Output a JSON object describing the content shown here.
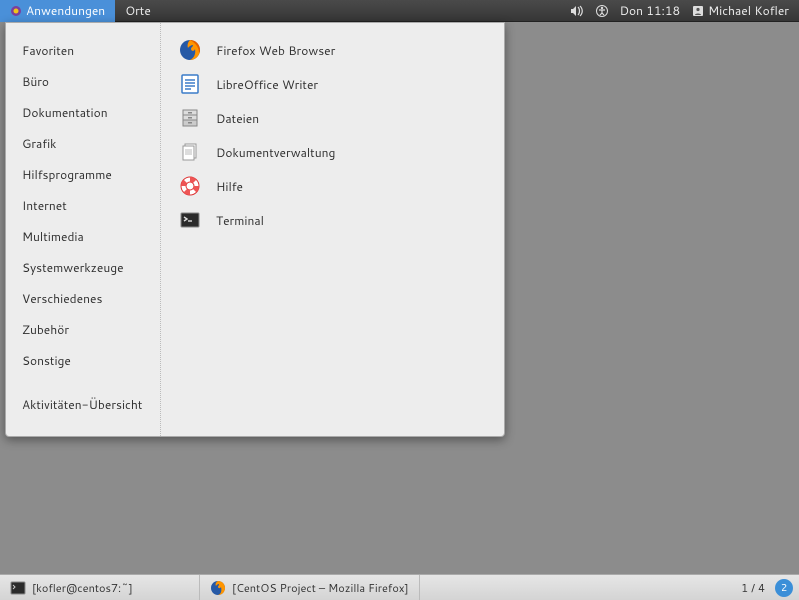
{
  "top_panel": {
    "apps_label": "Anwendungen",
    "places_label": "Orte",
    "datetime": "Don 11:18",
    "user": "Michael Kofler"
  },
  "menu": {
    "categories": [
      "Favoriten",
      "Büro",
      "Dokumentation",
      "Grafik",
      "Hilfsprogramme",
      "Internet",
      "Multimedia",
      "Systemwerkzeuge",
      "Verschiedenes",
      "Zubehör",
      "Sonstige"
    ],
    "activities": "Aktivitäten-Übersicht",
    "apps": [
      "Firefox Web Browser",
      "LibreOffice Writer",
      "Dateien",
      "Dokumentverwaltung",
      "Hilfe",
      "Terminal"
    ]
  },
  "tasks": {
    "terminal": "[kofler@centos7:~]",
    "firefox": "[CentOS Project – Mozilla Firefox]"
  },
  "bottom": {
    "workspace": "1 / 4",
    "notif_count": "2"
  }
}
